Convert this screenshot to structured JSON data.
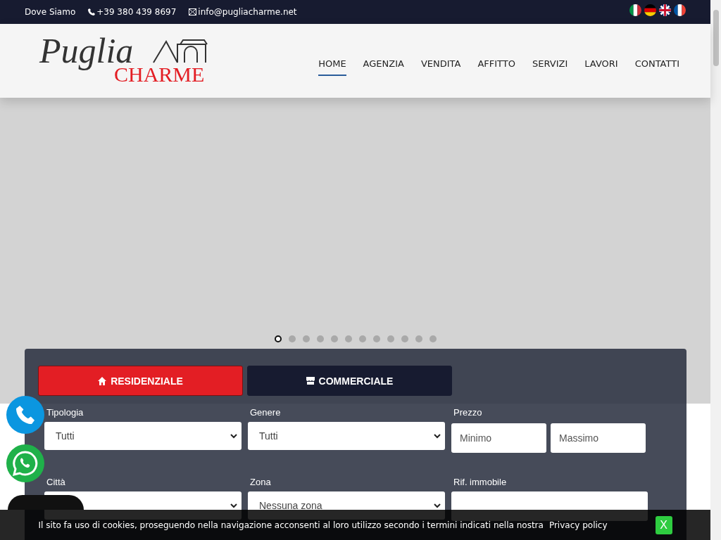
{
  "topbar": {
    "location": "Dove Siamo",
    "phone": "+39 380 439 8697",
    "email": "info@pugliacharme.net",
    "languages": [
      {
        "kind": "it"
      },
      {
        "kind": "de"
      },
      {
        "kind": "en"
      },
      {
        "kind": "fr"
      }
    ]
  },
  "logo": {
    "word": "Puglia",
    "sub": "CHARME"
  },
  "nav": [
    {
      "label": "HOME",
      "selected": true
    },
    {
      "label": "AGENZIA",
      "selected": false
    },
    {
      "label": "VENDITA",
      "selected": false
    },
    {
      "label": "AFFITTO",
      "selected": false
    },
    {
      "label": "SERVIZI",
      "selected": false
    },
    {
      "label": "LAVORI",
      "selected": false
    },
    {
      "label": "CONTATTI",
      "selected": false
    }
  ],
  "slider": {
    "dots": [
      {
        "selected": true
      },
      {
        "selected": false
      },
      {
        "selected": false
      },
      {
        "selected": false
      },
      {
        "selected": false
      },
      {
        "selected": false
      },
      {
        "selected": false
      },
      {
        "selected": false
      },
      {
        "selected": false
      },
      {
        "selected": false
      },
      {
        "selected": false
      },
      {
        "selected": false
      }
    ]
  },
  "search": {
    "tabs": [
      {
        "label": "RESIDENZIALE",
        "kind": "home",
        "selected": true
      },
      {
        "label": "COMMERCIALE",
        "kind": "shop",
        "selected": false
      }
    ],
    "fields": [
      {
        "label": "Tipologia",
        "kind": "select",
        "value": "Tutti"
      },
      {
        "label": "Genere",
        "kind": "select",
        "value": "Tutti"
      },
      {
        "label": "Prezzo",
        "kind": "range",
        "placeholders": [
          "Minimo",
          "Massimo"
        ]
      },
      {
        "label": "Città",
        "kind": "select"
      },
      {
        "label": "Zona",
        "kind": "select",
        "value": "Nessuna zona"
      },
      {
        "label": "Rif. immobile",
        "kind": "text"
      }
    ]
  },
  "cookie": {
    "text": "Il sito fa uso di cookies, proseguendo nella navigazione acconsenti al loro utilizzo secondo i termini indicati nella nostra",
    "link": "Privacy policy",
    "close": "X"
  }
}
